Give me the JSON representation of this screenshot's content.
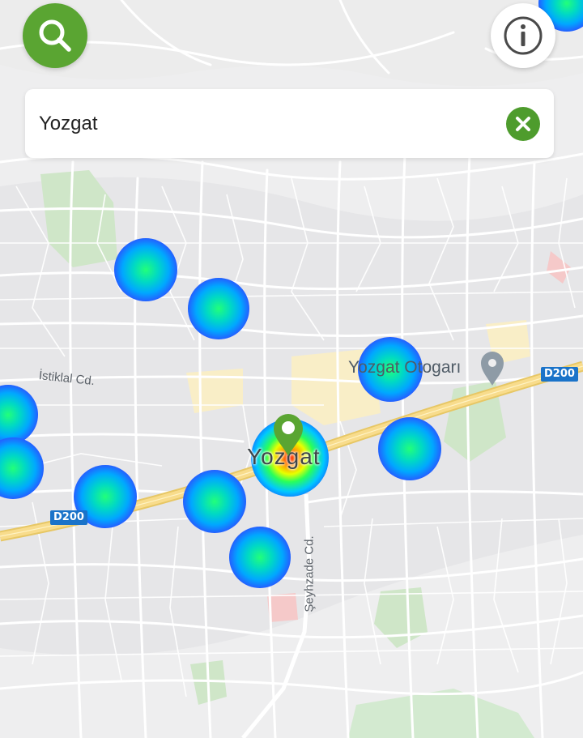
{
  "search": {
    "query": "Yozgat",
    "search_button_icon": "search-icon",
    "info_button_icon": "info-icon",
    "clear_button_icon": "close-icon"
  },
  "map": {
    "city_label": "Yozgat",
    "poi_label": "Yozgat Otogarı",
    "streets": {
      "istiklal": "İstiklal Cd.",
      "seyhzade": "Şeyhzade Cd."
    },
    "highway_shields": [
      "D200",
      "D200"
    ],
    "marker_icon": "map-pin-icon",
    "poi_icon": "place-pin-icon"
  },
  "colors": {
    "accent_green": "#5aa532",
    "clear_green": "#4e9c2d",
    "highway_shield": "#1a73c9",
    "highway_road": "#f7d67a"
  }
}
